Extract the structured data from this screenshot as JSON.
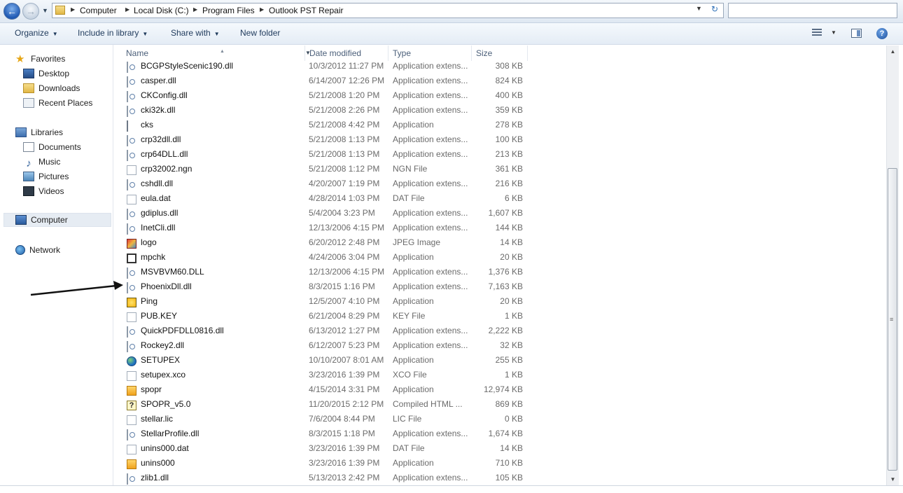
{
  "address": {
    "breadcrumbs": [
      "Computer",
      "Local Disk (C:)",
      "Program Files",
      "Outlook PST Repair"
    ]
  },
  "toolbar": {
    "organize": "Organize",
    "include_in_library": "Include in library",
    "share_with": "Share with",
    "new_folder": "New folder"
  },
  "nav": {
    "favorites": "Favorites",
    "desktop": "Desktop",
    "downloads": "Downloads",
    "recent_places": "Recent Places",
    "libraries": "Libraries",
    "documents": "Documents",
    "music": "Music",
    "pictures": "Pictures",
    "videos": "Videos",
    "computer": "Computer",
    "network": "Network"
  },
  "columns": {
    "name": "Name",
    "date_modified": "Date modified",
    "type": "Type",
    "size": "Size"
  },
  "files": [
    {
      "name": "BCGPStyleScenic190.dll",
      "date": "10/3/2012 11:27 PM",
      "type": "Application extens...",
      "size": "308 KB",
      "icon": "dll-icon"
    },
    {
      "name": "casper.dll",
      "date": "6/14/2007 12:26 PM",
      "type": "Application extens...",
      "size": "824 KB",
      "icon": "dll-icon"
    },
    {
      "name": "CKConfig.dll",
      "date": "5/21/2008 1:20 PM",
      "type": "Application extens...",
      "size": "400 KB",
      "icon": "dll-icon"
    },
    {
      "name": "cki32k.dll",
      "date": "5/21/2008 2:26 PM",
      "type": "Application extens...",
      "size": "359 KB",
      "icon": "dll-icon"
    },
    {
      "name": "cks",
      "date": "5/21/2008 4:42 PM",
      "type": "Application",
      "size": "278 KB",
      "icon": "app-icon"
    },
    {
      "name": "crp32dll.dll",
      "date": "5/21/2008 1:13 PM",
      "type": "Application extens...",
      "size": "100 KB",
      "icon": "dll-icon"
    },
    {
      "name": "crp64DLL.dll",
      "date": "5/21/2008 1:13 PM",
      "type": "Application extens...",
      "size": "213 KB",
      "icon": "dll-icon"
    },
    {
      "name": "crp32002.ngn",
      "date": "5/21/2008 1:12 PM",
      "type": "NGN File",
      "size": "361 KB",
      "icon": "blank-file-icon"
    },
    {
      "name": "cshdll.dll",
      "date": "4/20/2007 1:19 PM",
      "type": "Application extens...",
      "size": "216 KB",
      "icon": "dll-icon"
    },
    {
      "name": "eula.dat",
      "date": "4/28/2014 1:03 PM",
      "type": "DAT File",
      "size": "6 KB",
      "icon": "blank-file-icon"
    },
    {
      "name": "gdiplus.dll",
      "date": "5/4/2004 3:23 PM",
      "type": "Application extens...",
      "size": "1,607 KB",
      "icon": "dll-icon"
    },
    {
      "name": "InetCli.dll",
      "date": "12/13/2006 4:15 PM",
      "type": "Application extens...",
      "size": "144 KB",
      "icon": "dll-icon"
    },
    {
      "name": "logo",
      "date": "6/20/2012 2:48 PM",
      "type": "JPEG Image",
      "size": "14 KB",
      "icon": "jpeg-icon"
    },
    {
      "name": "mpchk",
      "date": "4/24/2006 3:04 PM",
      "type": "Application",
      "size": "20 KB",
      "icon": "mpchk-icon"
    },
    {
      "name": "MSVBVM60.DLL",
      "date": "12/13/2006 4:15 PM",
      "type": "Application extens...",
      "size": "1,376 KB",
      "icon": "dll-icon"
    },
    {
      "name": "PhoenixDll.dll",
      "date": "8/3/2015 1:16 PM",
      "type": "Application extens...",
      "size": "7,163 KB",
      "icon": "dll-icon"
    },
    {
      "name": "Ping",
      "date": "12/5/2007 4:10 PM",
      "type": "Application",
      "size": "20 KB",
      "icon": "ping-icon"
    },
    {
      "name": "PUB.KEY",
      "date": "6/21/2004 8:29 PM",
      "type": "KEY File",
      "size": "1 KB",
      "icon": "blank-file-icon"
    },
    {
      "name": "QuickPDFDLL0816.dll",
      "date": "6/13/2012 1:27 PM",
      "type": "Application extens...",
      "size": "2,222 KB",
      "icon": "dll-icon"
    },
    {
      "name": "Rockey2.dll",
      "date": "6/12/2007 5:23 PM",
      "type": "Application extens...",
      "size": "32 KB",
      "icon": "dll-icon"
    },
    {
      "name": "SETUPEX",
      "date": "10/10/2007 8:01 AM",
      "type": "Application",
      "size": "255 KB",
      "icon": "globe-icon"
    },
    {
      "name": "setupex.xco",
      "date": "3/23/2016 1:39 PM",
      "type": "XCO File",
      "size": "1 KB",
      "icon": "blank-file-icon"
    },
    {
      "name": "spopr",
      "date": "4/15/2014 3:31 PM",
      "type": "Application",
      "size": "12,974 KB",
      "icon": "spopr-icon"
    },
    {
      "name": "SPOPR_v5.0",
      "date": "11/20/2015 2:12 PM",
      "type": "Compiled HTML ...",
      "size": "869 KB",
      "icon": "chm-help-icon"
    },
    {
      "name": "stellar.lic",
      "date": "7/6/2004 8:44 PM",
      "type": "LIC File",
      "size": "0 KB",
      "icon": "blank-file-icon"
    },
    {
      "name": "StellarProfile.dll",
      "date": "8/3/2015 1:18 PM",
      "type": "Application extens...",
      "size": "1,674 KB",
      "icon": "dll-icon"
    },
    {
      "name": "unins000.dat",
      "date": "3/23/2016 1:39 PM",
      "type": "DAT File",
      "size": "14 KB",
      "icon": "blank-file-icon"
    },
    {
      "name": "unins000",
      "date": "3/23/2016 1:39 PM",
      "type": "Application",
      "size": "710 KB",
      "icon": "spopr-icon"
    },
    {
      "name": "zlib1.dll",
      "date": "5/13/2013 2:42 PM",
      "type": "Application extens...",
      "size": "105 KB",
      "icon": "dll-icon"
    }
  ]
}
